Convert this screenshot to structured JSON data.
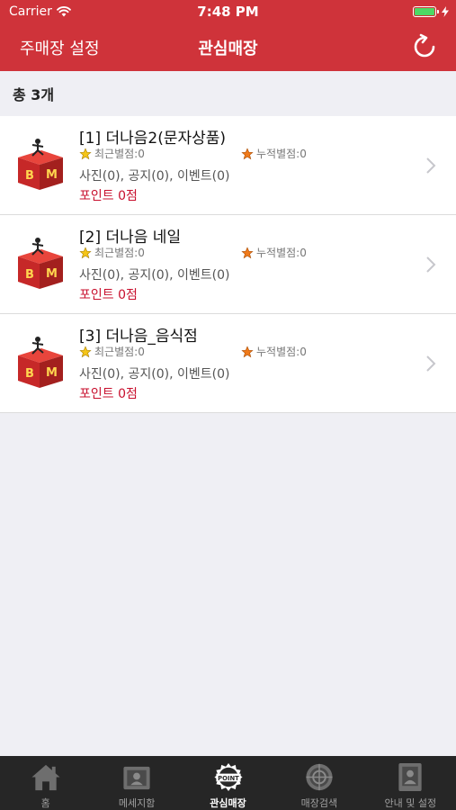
{
  "status_bar": {
    "carrier": "Carrier",
    "time": "7:48 PM"
  },
  "navbar": {
    "left_button": "주매장 설정",
    "title": "관심매장"
  },
  "count_label": "총 3개",
  "stores": [
    {
      "title": "[1] 더나음2(문자상품)",
      "recent_rating": "최근별점:0",
      "total_rating": "누적별점:0",
      "counts": "사진(0), 공지(0), 이벤트(0)",
      "points": "포인트 0점"
    },
    {
      "title": "[2] 더나음 네일",
      "recent_rating": "최근별점:0",
      "total_rating": "누적별점:0",
      "counts": "사진(0), 공지(0), 이벤트(0)",
      "points": "포인트 0점"
    },
    {
      "title": "[3] 더나음_음식점",
      "recent_rating": "최근별점:0",
      "total_rating": "누적별점:0",
      "counts": "사진(0), 공지(0), 이벤트(0)",
      "points": "포인트 0점"
    }
  ],
  "tabs": [
    {
      "label": "홈",
      "icon": "home-icon",
      "active": false
    },
    {
      "label": "메세지함",
      "icon": "message-icon",
      "active": false
    },
    {
      "label": "관심매장",
      "icon": "point-badge-icon",
      "active": true
    },
    {
      "label": "매장검색",
      "icon": "store-search-icon",
      "active": false
    },
    {
      "label": "안내 및 설정",
      "icon": "settings-icon",
      "active": false
    }
  ],
  "colors": {
    "header": "#cf333a",
    "points_text": "#c8102e",
    "tabbar": "#262626",
    "battery": "#4cd964"
  }
}
